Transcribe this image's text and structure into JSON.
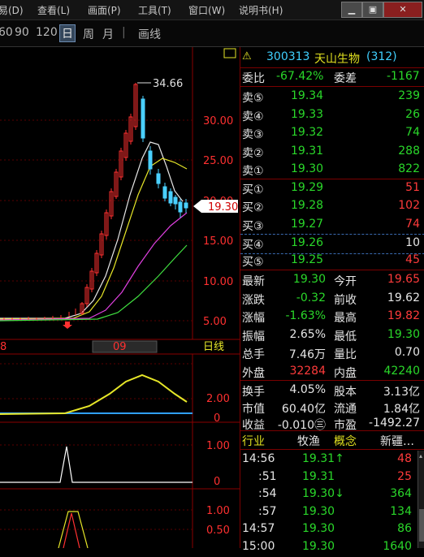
{
  "menu": {
    "items": [
      "易(D)",
      "查看(L)",
      "画面(P)",
      "工具(T)",
      "窗口(W)",
      "说明书(H)"
    ]
  },
  "window_buttons": [
    "▁",
    "▣",
    "✕"
  ],
  "toolbar": {
    "periods": [
      "60",
      "90",
      "120",
      "日",
      "周",
      "月"
    ],
    "selected": "日",
    "draw_label": "画线"
  },
  "chart": {
    "price_axis": [
      "30.00",
      "25.00",
      "20.00",
      "15.00",
      "10.00",
      "5.00"
    ],
    "high_label": "34.66",
    "current_tag": "19.30",
    "date_labels": [
      "8",
      "09"
    ],
    "kline_type": "日线",
    "ind1_axis": [
      "2.00",
      "0"
    ],
    "ind2_axis": [
      "1.00",
      "0"
    ],
    "ind3_axis": [
      "1.00",
      "0.50"
    ]
  },
  "quote": {
    "code": "300313",
    "name": "天山生物",
    "num": "(312)",
    "weibi_label": "委比",
    "weibi": "-67.42%",
    "weicha_label": "委差",
    "weicha": "-1167",
    "asks": [
      {
        "label": "卖⑤",
        "price": "19.34",
        "vol": "239"
      },
      {
        "label": "卖④",
        "price": "19.33",
        "vol": "26"
      },
      {
        "label": "卖③",
        "price": "19.32",
        "vol": "74"
      },
      {
        "label": "卖②",
        "price": "19.31",
        "vol": "288"
      },
      {
        "label": "卖①",
        "price": "19.30",
        "vol": "822"
      }
    ],
    "bids": [
      {
        "label": "买①",
        "price": "19.29",
        "vol": "51"
      },
      {
        "label": "买②",
        "price": "19.28",
        "vol": "102"
      },
      {
        "label": "买③",
        "price": "19.27",
        "vol": "74"
      },
      {
        "label": "买④",
        "price": "19.26",
        "vol": "10"
      },
      {
        "label": "买⑤",
        "price": "19.25",
        "vol": "45"
      }
    ],
    "stats": [
      {
        "l1": "最新",
        "v1": "19.30",
        "c1": "g",
        "l2": "今开",
        "v2": "19.65",
        "c2": "r"
      },
      {
        "l1": "涨跌",
        "v1": "-0.32",
        "c1": "g",
        "l2": "前收",
        "v2": "19.62",
        "c2": "w"
      },
      {
        "l1": "涨幅",
        "v1": "-1.63%",
        "c1": "g",
        "l2": "最高",
        "v2": "19.82",
        "c2": "r"
      },
      {
        "l1": "振幅",
        "v1": "2.65%",
        "c1": "w",
        "l2": "最低",
        "v2": "19.30",
        "c2": "g"
      },
      {
        "l1": "总手",
        "v1": "7.46万",
        "c1": "w",
        "l2": "量比",
        "v2": "0.70",
        "c2": "w"
      },
      {
        "l1": "外盘",
        "v1": "32284",
        "c1": "r",
        "l2": "内盘",
        "v2": "42240",
        "c2": "g"
      }
    ],
    "fund": [
      {
        "l1": "换手",
        "v1": "4.05%",
        "l2": "股本",
        "v2": "3.13亿"
      },
      {
        "l1": "市值",
        "v1": "60.40亿",
        "l2": "流通",
        "v2": "1.84亿"
      },
      {
        "l1": "收益",
        "v1": "-0.010㊂",
        "l2": "市盈",
        "v2": "-1492.27"
      }
    ],
    "industry_label": "行业",
    "industry": "牧渔",
    "concept_label": "概念",
    "concept": "新疆…",
    "ticks": [
      {
        "time": "14:56",
        "price": "19.31↑",
        "pc": "g",
        "vol": "48",
        "vc": "r"
      },
      {
        "time": ":51",
        "price": "19.31",
        "pc": "g",
        "vol": "25",
        "vc": "r"
      },
      {
        "time": ":54",
        "price": "19.30↓",
        "pc": "g",
        "vol": "364",
        "vc": "g"
      },
      {
        "time": ":57",
        "price": "19.30",
        "pc": "g",
        "vol": "134",
        "vc": "g"
      },
      {
        "time": "14:57",
        "price": "19.30",
        "pc": "g",
        "vol": "86",
        "vc": "g"
      },
      {
        "time": "15:00",
        "price": "19.30",
        "pc": "g",
        "vol": "1640",
        "vc": "g"
      }
    ]
  }
}
